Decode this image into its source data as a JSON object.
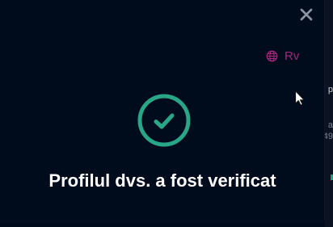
{
  "colors": {
    "background": "#000b1c",
    "accent_success": "#29a688",
    "language_text": "#a0287b",
    "close_icon": "#8d95a2",
    "title_text": "#ffffff"
  },
  "background_page": {
    "edge_fragments": [
      "p",
      "a",
      "49"
    ]
  },
  "modal": {
    "close_icon": "close-icon",
    "language": {
      "icon": "globe-icon",
      "label": "Rv"
    },
    "status": {
      "icon": "check-circle-icon",
      "message": "Profilul dvs. a fost verificat"
    }
  },
  "pointer": {
    "icon": "mouse-pointer-icon"
  }
}
